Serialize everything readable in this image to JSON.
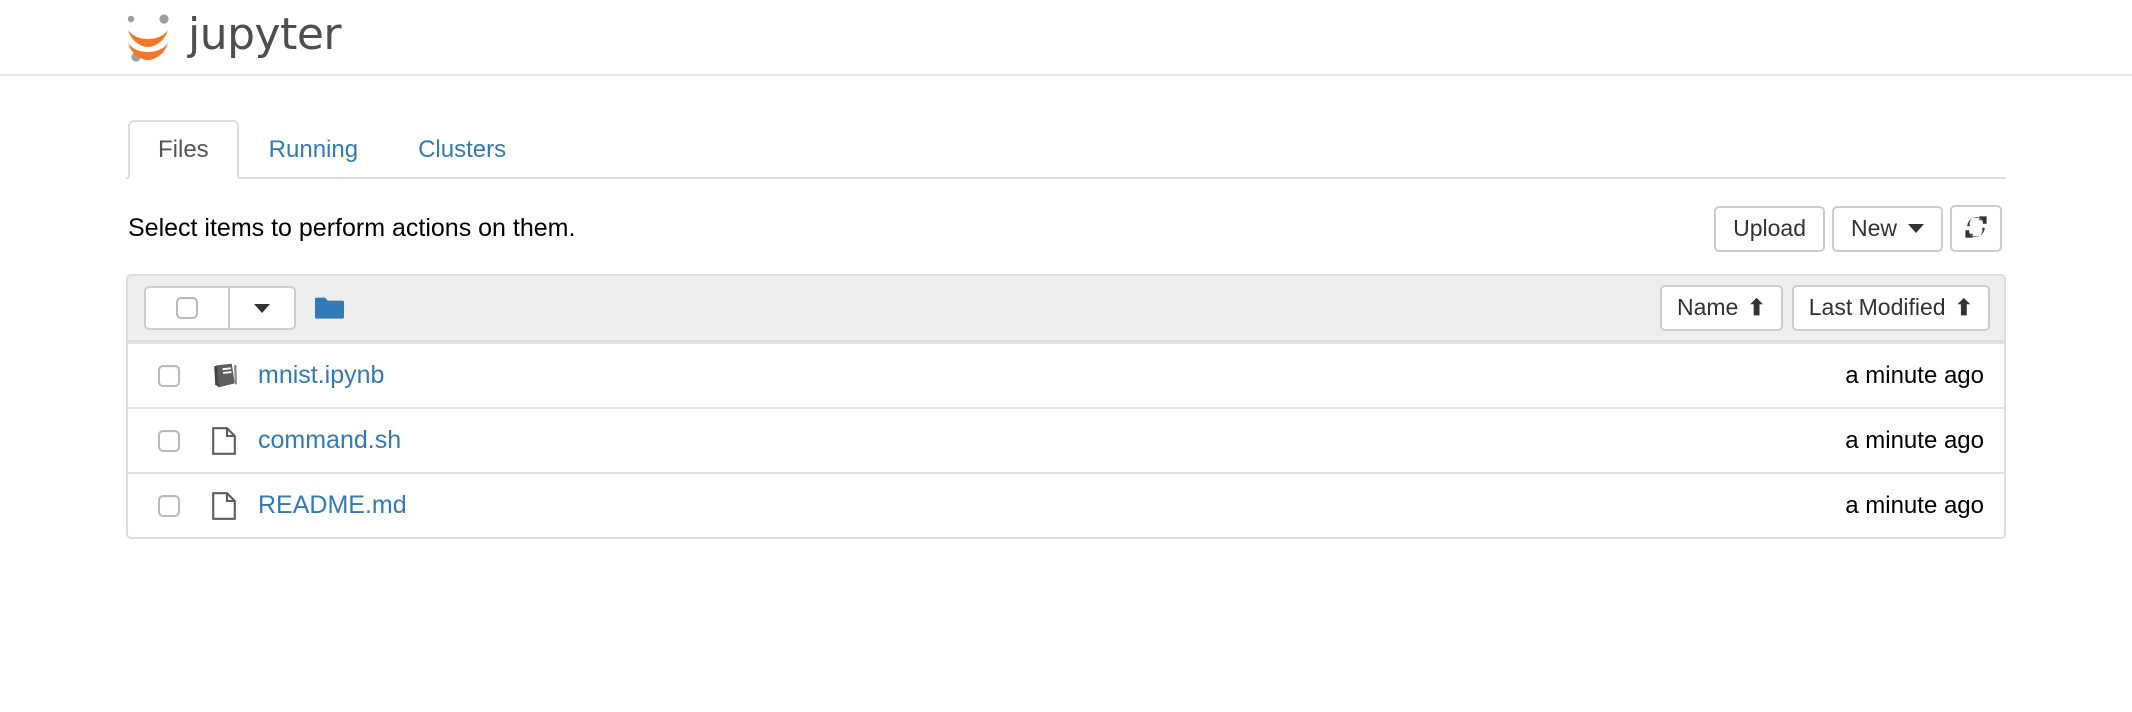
{
  "header": {
    "brand_text": "jupyter",
    "logo_icon": "jupyter-logo-icon",
    "logo_color": "#f37726",
    "logo_dot_color": "#9e9e9e"
  },
  "tabs": [
    {
      "label": "Files",
      "active": true,
      "name": "tab-files"
    },
    {
      "label": "Running",
      "active": false,
      "name": "tab-running"
    },
    {
      "label": "Clusters",
      "active": false,
      "name": "tab-clusters"
    }
  ],
  "toolbar": {
    "message": "Select items to perform actions on them.",
    "upload_label": "Upload",
    "new_label": "New",
    "new_caret_icon": "chevron-down-icon",
    "refresh_icon": "refresh-icon"
  },
  "list_header": {
    "select_all_checkbox": "",
    "select_dropdown_icon": "chevron-down-icon",
    "folder_icon": "folder-icon",
    "folder_color": "#337ab7",
    "sort_name_label": "Name",
    "sort_name_arrow": "⬆",
    "sort_modified_label": "Last Modified",
    "sort_modified_arrow": "⬆"
  },
  "files": [
    {
      "name": "mnist.ipynb",
      "icon": "notebook-icon",
      "modified": "a minute ago"
    },
    {
      "name": "command.sh",
      "icon": "file-icon",
      "modified": "a minute ago"
    },
    {
      "name": "README.md",
      "icon": "file-icon",
      "modified": "a minute ago"
    }
  ],
  "colors": {
    "link": "#337ab7",
    "accent_orange": "#f37726",
    "border": "#dddddd",
    "header_bg": "#eeeeee"
  }
}
